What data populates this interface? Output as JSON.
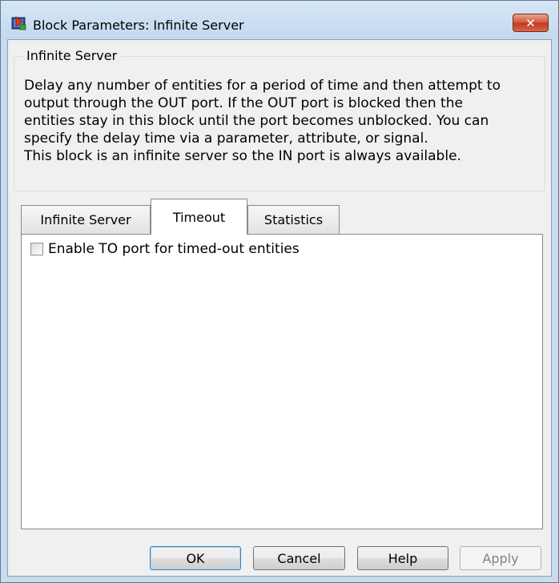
{
  "window": {
    "title": "Block Parameters: Infinite Server",
    "close_icon": "close-icon",
    "close_glyph": "✕"
  },
  "group": {
    "legend": "Infinite Server",
    "description_lines": [
      "Delay any number of entities for a period of time and then attempt to",
      "output through the OUT port. If the OUT port is blocked then the",
      "entities stay in this block until the port becomes unblocked. You can",
      "specify the delay time via a parameter, attribute, or signal.",
      "This block is an infinite server so the IN port is always available."
    ]
  },
  "tabs": [
    {
      "label": "Infinite Server",
      "active": false
    },
    {
      "label": "Timeout",
      "active": true
    },
    {
      "label": "Statistics",
      "active": false
    }
  ],
  "timeout_tab": {
    "checkbox_label": "Enable TO port for timed-out entities",
    "checked": false
  },
  "buttons": {
    "ok": "OK",
    "cancel": "Cancel",
    "help": "Help",
    "apply": "Apply"
  }
}
